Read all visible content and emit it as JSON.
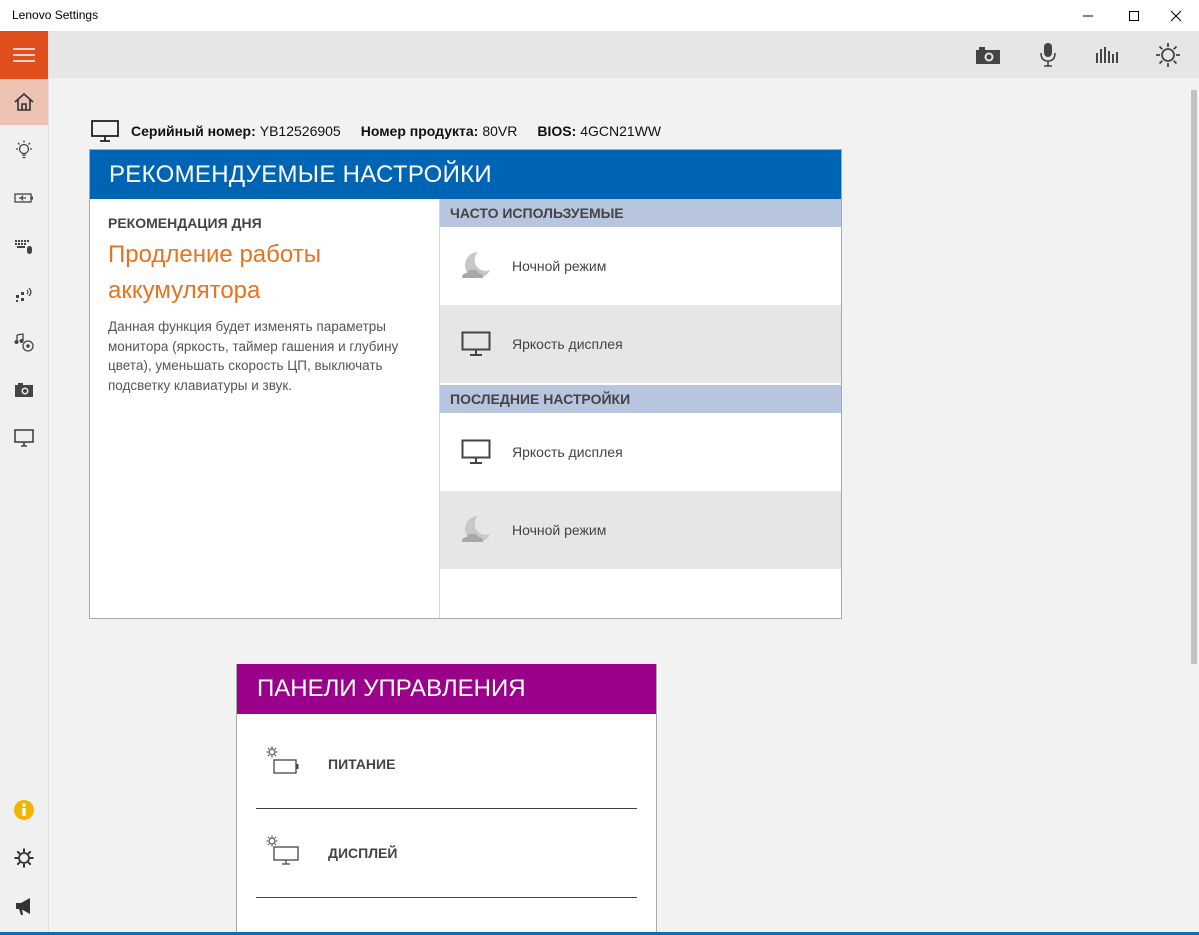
{
  "window": {
    "title": "Lenovo Settings",
    "minimize_glyph": "─",
    "maximize_glyph": "☐",
    "close_glyph": "✕"
  },
  "sidebar": {
    "menu_icon": "hamburger-icon",
    "accent_color": "#e04e1b",
    "items": [
      {
        "icon": "home-icon",
        "active": true
      },
      {
        "icon": "lightbulb-icon",
        "active": false
      },
      {
        "icon": "battery-icon",
        "active": false
      },
      {
        "icon": "keyboard-mouse-icon",
        "active": false
      },
      {
        "icon": "network-icon",
        "active": false
      },
      {
        "icon": "audio-video-icon",
        "active": false
      },
      {
        "icon": "camera-icon",
        "active": false
      },
      {
        "icon": "display-icon",
        "active": false
      }
    ],
    "bottom_items": [
      {
        "icon": "info-icon"
      },
      {
        "icon": "settings-gear-icon"
      },
      {
        "icon": "megaphone-icon"
      }
    ]
  },
  "toolbar": {
    "icons": [
      "camera-icon",
      "microphone-icon",
      "audio-levels-icon",
      "brightness-icon"
    ]
  },
  "system_info": {
    "serial_label": "Серийный номер:",
    "serial_value": "YB12526905",
    "product_label": "Номер продукта:",
    "product_value": "80VR",
    "bios_label": "BIOS:",
    "bios_value": "4GCN21WW"
  },
  "recommended": {
    "title": "РЕКОМЕНДУЕМЫЕ НАСТРОЙКИ",
    "header_color": "#0064b4",
    "tip": {
      "kicker": "РЕКОМЕНДАЦИЯ ДНЯ",
      "headline": "Продление работы аккумулятора",
      "description": "Данная функция будет изменять параметры монитора (яркость, таймер гашения и глубину цвета), уменьшать скорость ЦП, выключать подсветку клавиатуры и звук."
    },
    "frequent": {
      "title": "ЧАСТО ИСПОЛЬЗУЕМЫЕ",
      "items": [
        {
          "label": "Ночной режим",
          "icon": "night-mode-icon"
        },
        {
          "label": "Яркость дисплея",
          "icon": "monitor-icon"
        }
      ]
    },
    "recent": {
      "title": "ПОСЛЕДНИЕ НАСТРОЙКИ",
      "items": [
        {
          "label": "Яркость дисплея",
          "icon": "monitor-icon"
        },
        {
          "label": "Ночной режим",
          "icon": "night-mode-icon"
        }
      ]
    }
  },
  "control_panels": {
    "title": "ПАНЕЛИ УПРАВЛЕНИЯ",
    "header_color": "#9a0089",
    "items": [
      {
        "label": "ПИТАНИЕ",
        "icon": "power-settings-icon"
      },
      {
        "label": "ДИСПЛЕЙ",
        "icon": "display-settings-icon"
      }
    ]
  }
}
